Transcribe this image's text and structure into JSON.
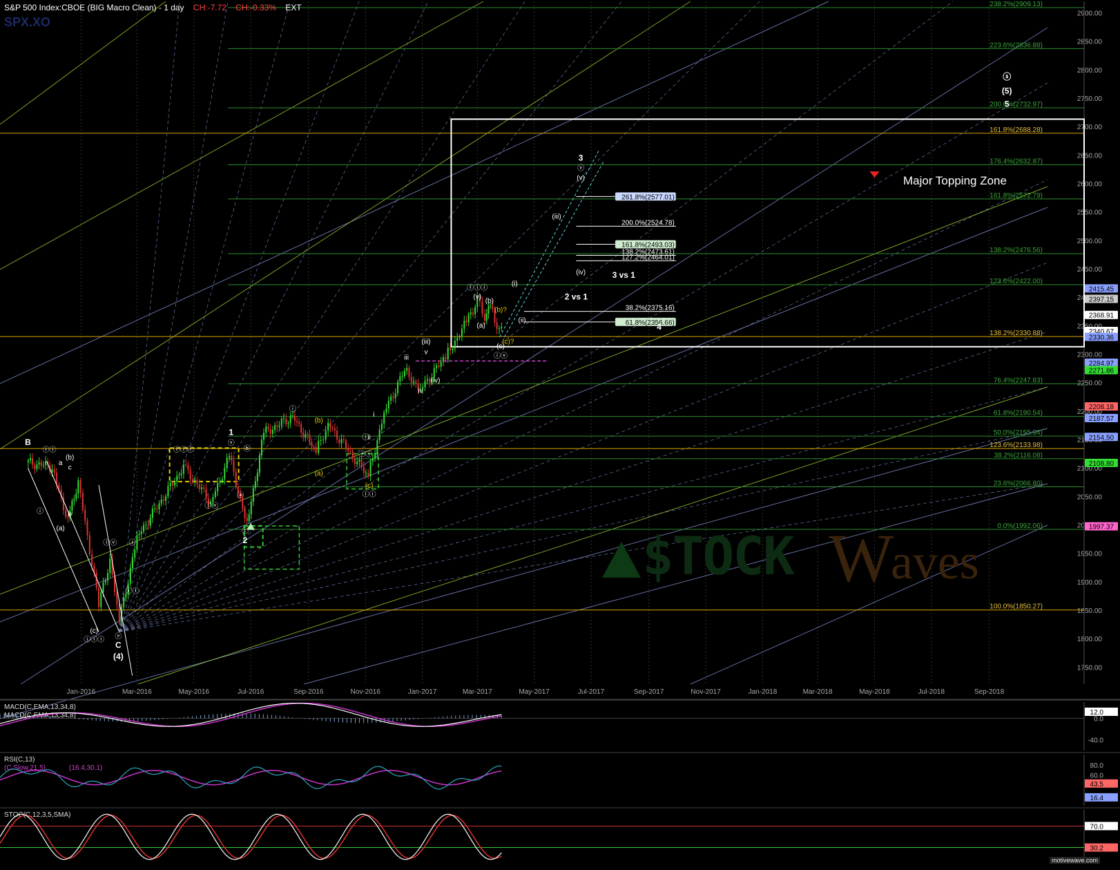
{
  "header": {
    "title": "S&P 500 Index:CBOE (BIG Macro Clean) - 1 day",
    "change": "CH:-7.72",
    "change_pct": "CH:-0.33%",
    "ext": "EXT",
    "symbol": "SPX.XO"
  },
  "watermark": {
    "logo_left": "$TOCK",
    "logo_w": "W",
    "logo_right": "aves"
  },
  "credit": "motivewave.com",
  "annotation": "Major Topping Zone",
  "colors": {
    "bg": "#000000",
    "fib_green": "#2e8b2e",
    "fib_gold": "#d9a400",
    "fan_blue": "#7d8cc8",
    "fan_green": "#9acd32",
    "up_bar": "#33dd33",
    "down_bar": "#dd3333"
  },
  "chart_data": [
    {
      "type": "candlestick",
      "title": "S&P 500 Index:CBOE (BIG Macro Clean) - 1 day",
      "x_tick_labels": [
        "Jan-2016",
        "Mar-2016",
        "May-2016",
        "Jul-2016",
        "Sep-2016",
        "Nov-2016",
        "Jan-2017",
        "Mar-2017",
        "May-2017",
        "Jul-2017",
        "Sep-2017",
        "Nov-2017",
        "Jan-2018",
        "Mar-2018",
        "May-2018",
        "Jul-2018",
        "Sep-2018"
      ],
      "y_tick_labels": [
        "2900.00",
        "2850.00",
        "2800.00",
        "2750.00",
        "2700.00",
        "2650.00",
        "2600.00",
        "2550.00",
        "2500.00",
        "2450.00",
        "2400.00",
        "2350.00",
        "2300.00",
        "2250.00",
        "2200.00",
        "2150.00",
        "2100.00",
        "2050.00",
        "2000.00",
        "1950.00",
        "1900.00",
        "1850.00",
        "1800.00",
        "1750.00"
      ],
      "ylim": [
        1720,
        2920
      ],
      "price_series": [
        {
          "date": "2015-11-03",
          "close": 2110
        },
        {
          "date": "2015-12-01",
          "close": 2102
        },
        {
          "date": "2015-12-18",
          "close": 2005
        },
        {
          "date": "2015-12-29",
          "close": 2078
        },
        {
          "date": "2016-01-20",
          "close": 1859
        },
        {
          "date": "2016-02-01",
          "close": 1939
        },
        {
          "date": "2016-02-11",
          "close": 1829
        },
        {
          "date": "2016-03-01",
          "close": 1978
        },
        {
          "date": "2016-04-20",
          "close": 2102
        },
        {
          "date": "2016-05-19",
          "close": 2040
        },
        {
          "date": "2016-06-08",
          "close": 2119
        },
        {
          "date": "2016-06-27",
          "close": 2000
        },
        {
          "date": "2016-07-15",
          "close": 2161
        },
        {
          "date": "2016-08-15",
          "close": 2190
        },
        {
          "date": "2016-09-09",
          "close": 2128
        },
        {
          "date": "2016-09-22",
          "close": 2177
        },
        {
          "date": "2016-11-04",
          "close": 2085
        },
        {
          "date": "2016-11-21",
          "close": 2198
        },
        {
          "date": "2016-12-13",
          "close": 2271
        },
        {
          "date": "2016-12-30",
          "close": 2238
        },
        {
          "date": "2017-01-26",
          "close": 2296
        },
        {
          "date": "2017-02-15",
          "close": 2349
        },
        {
          "date": "2017-03-01",
          "close": 2395
        },
        {
          "date": "2017-03-09",
          "close": 2364
        },
        {
          "date": "2017-03-15",
          "close": 2385
        },
        {
          "date": "2017-03-22",
          "close": 2348
        },
        {
          "date": "2017-03-27",
          "close": 2341
        }
      ],
      "price_tags": [
        {
          "value": 2415.45,
          "label": "2415.45",
          "color": "#8aa0ff"
        },
        {
          "value": 2397.15,
          "label": "2397.15",
          "color": "#cccccc"
        },
        {
          "value": 2368.91,
          "label": "2368.91",
          "color": "#ffffff"
        },
        {
          "value": 2340.67,
          "label": "2340.67",
          "color": "#ffffff"
        },
        {
          "value": 2330.36,
          "label": "2330.36",
          "color": "#8aa0ff"
        },
        {
          "value": 2284.97,
          "label": "2284.97",
          "color": "#8aa0ff"
        },
        {
          "value": 2271.86,
          "label": "2271.86",
          "color": "#33dd33"
        },
        {
          "value": 2208.18,
          "label": "2208.18",
          "color": "#ff6666"
        },
        {
          "value": 2187.57,
          "label": "2187.57",
          "color": "#8aa0ff"
        },
        {
          "value": 2154.5,
          "label": "2154.50",
          "color": "#8aa0ff"
        },
        {
          "value": 2108.8,
          "label": "2108.80",
          "color": "#33dd33"
        },
        {
          "value": 1997.37,
          "label": "1997.37",
          "color": "#ff66cc"
        }
      ],
      "fib_levels": [
        {
          "value": 2909.13,
          "label": "238.2%(2909.13)",
          "color": "#2e8b2e"
        },
        {
          "value": 2836.88,
          "label": "223.6%(2836.88)",
          "color": "#2e8b2e"
        },
        {
          "value": 2732.97,
          "label": "200.0%(2732.97)",
          "color": "#2e8b2e"
        },
        {
          "value": 2688.28,
          "label": "161.8%(2688.28)",
          "color": "#d9a400"
        },
        {
          "value": 2632.87,
          "label": "176.4%(2632.87)",
          "color": "#2e8b2e"
        },
        {
          "value": 2572.79,
          "label": "161.8%(2572.79)",
          "color": "#2e8b2e"
        },
        {
          "value": 2476.56,
          "label": "138.2%(2476.56)",
          "color": "#2e8b2e"
        },
        {
          "value": 2422.0,
          "label": "123.6%(2422.00)",
          "color": "#2e8b2e"
        },
        {
          "value": 2330.88,
          "label": "138.2%(2330.88)",
          "color": "#d9a400"
        },
        {
          "value": 2247.83,
          "label": "76.4%(2247.83)",
          "color": "#2e8b2e"
        },
        {
          "value": 2190.54,
          "label": "61.8%(2190.54)",
          "color": "#2e8b2e"
        },
        {
          "value": 2155.94,
          "label": "50.0%(2155.94)",
          "color": "#2e8b2e"
        },
        {
          "value": 2133.98,
          "label": "123.6%(2133.98)",
          "color": "#d9a400"
        },
        {
          "value": 2116.08,
          "label": "38.2%(2116.08)",
          "color": "#2e8b2e"
        },
        {
          "value": 2066.8,
          "label": "23.6%(2066.80)",
          "color": "#2e8b2e"
        },
        {
          "value": 1992.06,
          "label": "0.0%(1992.06)",
          "color": "#2e8b2e"
        },
        {
          "value": 1850.27,
          "label": "100.0%(1850.27)",
          "color": "#d9a400"
        }
      ],
      "projections": [
        {
          "value": 2577.01,
          "label": "261.8%(2577.01)",
          "boxed": true
        },
        {
          "value": 2524.78,
          "label": "200.0%(2524.78)",
          "boxed": false
        },
        {
          "value": 2493.03,
          "label": "161.8%(2493.03)",
          "boxed": true
        },
        {
          "value": 2473.61,
          "label": "138.2%(2473.61)",
          "boxed": false
        },
        {
          "value": 2464.01,
          "label": "127.2%(2464.01)",
          "boxed": false
        },
        {
          "value": 2375.16,
          "label": "38.2%(2375.16)",
          "boxed": false
        },
        {
          "value": 2356.66,
          "label": "61.8%(2356.66)",
          "boxed": true
        }
      ],
      "wave_labels": [
        {
          "date": "2015-11-05",
          "value": 2140,
          "text": "B",
          "color": "#fff",
          "bold": true
        },
        {
          "date": "2015-11-28",
          "value": 2128,
          "text": "ⓘⓘ",
          "color": "#fff"
        },
        {
          "date": "2015-12-10",
          "value": 2105,
          "text": "a",
          "color": "#fff"
        },
        {
          "date": "2015-12-20",
          "value": 2115,
          "text": "(b)",
          "color": "#fff"
        },
        {
          "date": "2015-12-20",
          "value": 2097,
          "text": "c",
          "color": "#fff"
        },
        {
          "date": "2015-12-20",
          "value": 2015,
          "text": "b",
          "color": "#fff"
        },
        {
          "date": "2015-12-10",
          "value": 1990,
          "text": "(a)",
          "color": "#fff"
        },
        {
          "date": "2015-11-18",
          "value": 2020,
          "text": "ⓘ",
          "color": "#fff"
        },
        {
          "date": "2016-01-15",
          "value": 1810,
          "text": "(c)",
          "color": "#fff"
        },
        {
          "date": "2016-01-15",
          "value": 1795,
          "text": "ⓘⓘⓘ",
          "color": "#fff"
        },
        {
          "date": "2016-02-10",
          "value": 1800,
          "text": "ⓥ",
          "color": "#fff"
        },
        {
          "date": "2016-02-10",
          "value": 1784,
          "text": "C",
          "color": "#fff",
          "bold": true
        },
        {
          "date": "2016-02-10",
          "value": 1764,
          "text": "(4)",
          "color": "#fff",
          "bold": true
        },
        {
          "date": "2016-02-01",
          "value": 1965,
          "text": "ⓘⓥ",
          "color": "#fff"
        },
        {
          "date": "2016-02-25",
          "value": 1965,
          "text": "ⓘ",
          "color": "#fff"
        },
        {
          "date": "2016-02-25",
          "value": 1880,
          "text": "ⓘⓘ",
          "color": "#fff"
        },
        {
          "date": "2016-04-20",
          "value": 2128,
          "text": "ⓘⓘⓘ",
          "color": "#fff"
        },
        {
          "date": "2016-05-20",
          "value": 2030,
          "text": "ⓘⓥ",
          "color": "#fff"
        },
        {
          "date": "2016-06-10",
          "value": 2140,
          "text": "ⓥ",
          "color": "#fff"
        },
        {
          "date": "2016-06-10",
          "value": 2158,
          "text": "1",
          "color": "#fff",
          "bold": true
        },
        {
          "date": "2016-06-20",
          "value": 2048,
          "text": "ⓐ",
          "color": "#fff"
        },
        {
          "date": "2016-06-27",
          "value": 2130,
          "text": "ⓑ",
          "color": "#fff"
        },
        {
          "date": "2016-06-25",
          "value": 1985,
          "text": "ⓒ",
          "color": "#fff"
        },
        {
          "date": "2016-06-25",
          "value": 1968,
          "text": "2",
          "color": "#fff",
          "bold": true
        },
        {
          "date": "2016-08-15",
          "value": 2200,
          "text": "ⓘ",
          "color": "#fff"
        },
        {
          "date": "2016-09-12",
          "value": 2180,
          "text": "(b)",
          "color": "#e6d000"
        },
        {
          "date": "2016-09-12",
          "value": 2087,
          "text": "(a)",
          "color": "#e6d000"
        },
        {
          "date": "2016-11-01",
          "value": 2150,
          "text": "ⓘ",
          "color": "#fff"
        },
        {
          "date": "2016-11-01",
          "value": 2120,
          "text": "ⓘⓘ",
          "color": "#fff"
        },
        {
          "date": "2016-11-05",
          "value": 2150,
          "text": "ii",
          "color": "#fff"
        },
        {
          "date": "2016-11-05",
          "value": 2065,
          "text": "(c)",
          "color": "#e6d000"
        },
        {
          "date": "2016-11-05",
          "value": 2050,
          "text": "ⓘⓘ",
          "color": "#fff"
        },
        {
          "date": "2016-11-10",
          "value": 2190,
          "text": "i",
          "color": "#fff"
        },
        {
          "date": "2016-12-15",
          "value": 2290,
          "text": "iii",
          "color": "#fff"
        },
        {
          "date": "2016-12-30",
          "value": 2232,
          "text": "iv",
          "color": "#fff"
        },
        {
          "date": "2017-01-05",
          "value": 2300,
          "text": "v",
          "color": "#fff"
        },
        {
          "date": "2017-01-05",
          "value": 2318,
          "text": "(iii)",
          "color": "#fff"
        },
        {
          "date": "2017-01-15",
          "value": 2250,
          "text": "(iv)",
          "color": "#fff"
        },
        {
          "date": "2017-03-01",
          "value": 2413,
          "text": "ⓘⓘⓘ",
          "color": "#fff"
        },
        {
          "date": "2017-03-01",
          "value": 2397,
          "text": "(v)",
          "color": "#fff"
        },
        {
          "date": "2017-03-05",
          "value": 2347,
          "text": "(a)",
          "color": "#fff"
        },
        {
          "date": "2017-03-14",
          "value": 2390,
          "text": "(b)",
          "color": "#fff"
        },
        {
          "date": "2017-03-26",
          "value": 2374,
          "text": "(b)?",
          "color": "#e6d000"
        },
        {
          "date": "2017-03-26",
          "value": 2310,
          "text": "(c)",
          "color": "#fff"
        },
        {
          "date": "2017-03-26",
          "value": 2293,
          "text": "ⓘⓥ",
          "color": "#fff"
        },
        {
          "date": "2017-04-03",
          "value": 2318,
          "text": "(c)?",
          "color": "#e6d000"
        },
        {
          "date": "2017-04-10",
          "value": 2420,
          "text": "(i)",
          "color": "#fff"
        },
        {
          "date": "2017-04-18",
          "value": 2356,
          "text": "(ii)",
          "color": "#fff"
        },
        {
          "date": "2017-05-25",
          "value": 2538,
          "text": "(iii)",
          "color": "#fff"
        },
        {
          "date": "2017-06-20",
          "value": 2440,
          "text": "(iv)",
          "color": "#fff"
        },
        {
          "date": "2017-06-20",
          "value": 2640,
          "text": "3",
          "color": "#fff",
          "bold": true
        },
        {
          "date": "2017-06-20",
          "value": 2623,
          "text": "ⓥ",
          "color": "#fff"
        },
        {
          "date": "2017-06-20",
          "value": 2606,
          "text": "(v)",
          "color": "#fff"
        },
        {
          "date": "2017-06-15",
          "value": 2396,
          "text": "2 vs 1",
          "color": "#fff",
          "bold": true
        },
        {
          "date": "2017-08-05",
          "value": 2434,
          "text": "3 vs 1",
          "color": "#fff",
          "bold": true
        },
        {
          "date": "2017-09-12",
          "value": 2343,
          "text": "4",
          "color": "#fff",
          "bold": true
        },
        {
          "date": "2018-09-20",
          "value": 2783,
          "text": "ⓢ",
          "color": "#fff",
          "bold": true
        },
        {
          "date": "2018-09-20",
          "value": 2758,
          "text": "(5)",
          "color": "#fff",
          "bold": true
        },
        {
          "date": "2018-09-20",
          "value": 2735,
          "text": "5",
          "color": "#fff",
          "bold": true
        }
      ]
    },
    {
      "type": "line",
      "title": "MACD(C,EMA,13,34,8)",
      "legend": [
        "MACD(C,EMA,13,34,8)",
        "MACD(C,EMA,13,34,8)"
      ],
      "y_tick_labels": [
        "12.0",
        "0.0",
        "-40.0"
      ],
      "ylim": [
        -60,
        30
      ]
    },
    {
      "type": "line",
      "title": "RSI(C,13)",
      "legend": [
        "RSI(C,13)",
        "(C,Slow,21,5)",
        "(16.4,30.1)"
      ],
      "y_tick_labels": [
        "80.0",
        "60.0",
        "43.5",
        "16.4"
      ],
      "ylim": [
        0,
        100
      ]
    },
    {
      "type": "line",
      "title": "STOC(C,12,3,5,SMA)",
      "legend": [
        "STOC(C,12,3,5,SMA)"
      ],
      "y_tick_labels": [
        "70.0",
        "30.2"
      ],
      "ylim": [
        0,
        100
      ]
    }
  ]
}
